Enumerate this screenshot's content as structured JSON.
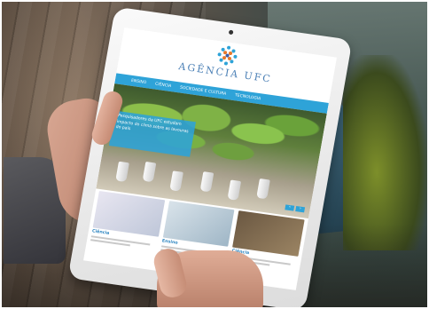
{
  "site": {
    "logo_text": "AGÊNCIA UFC",
    "nav": [
      "ENSINO",
      "CIÊNCIA",
      "SOCIEDADE E CULTURA",
      "TECNOLOGIA"
    ]
  },
  "hero": {
    "caption": "Pesquisadores da UFC estudam impacto do clima sobre as lavouras do país",
    "prev": "‹",
    "next": "›"
  },
  "cards": [
    {
      "title": "Ciência"
    },
    {
      "title": "Ensino"
    },
    {
      "title": "Ciência"
    }
  ],
  "colors": {
    "accent": "#2ea3d8",
    "logo": "#4a7fb5"
  }
}
